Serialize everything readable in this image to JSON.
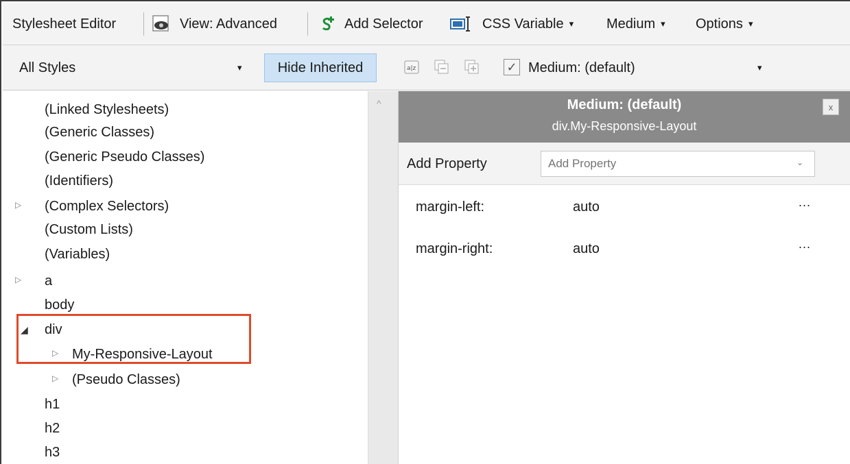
{
  "toolbar": {
    "title": "Stylesheet Editor",
    "view_label": "View: Advanced",
    "add_selector_label": "Add Selector",
    "css_variable_label": "CSS Variable",
    "medium_label": "Medium",
    "options_label": "Options",
    "caret": "▾"
  },
  "filter_bar": {
    "style_filter_value": "All Styles",
    "hide_inherited_label": "Hide Inherited",
    "medium_checked": "✓",
    "medium_value": "Medium: (default)",
    "dropdown_arrow": "▾"
  },
  "tree": {
    "items": [
      {
        "label": "(Linked Stylesheets)"
      },
      {
        "label": "(Generic Classes)"
      },
      {
        "label": "(Generic Pseudo Classes)"
      },
      {
        "label": "(Identifiers)"
      },
      {
        "label": "(Complex Selectors)"
      },
      {
        "label": "(Custom Lists)"
      },
      {
        "label": "(Variables)"
      },
      {
        "label": "a"
      },
      {
        "label": "body"
      },
      {
        "label": "div"
      },
      {
        "label": "My-Responsive-Layout"
      },
      {
        "label": "(Pseudo Classes)"
      },
      {
        "label": "h1"
      },
      {
        "label": "h2"
      },
      {
        "label": "h3"
      }
    ],
    "collapsed_glyph": "▷",
    "expanded_glyph": "◢"
  },
  "properties_panel": {
    "medium_title": "Medium: (default)",
    "selector": "div.My-Responsive-Layout",
    "close_glyph": "x",
    "add_property_label": "Add Property",
    "add_property_placeholder": "Add Property",
    "add_property_arrow": "⌄",
    "properties": [
      {
        "name": "margin-left:",
        "value": "auto",
        "more": "..."
      },
      {
        "name": "margin-right:",
        "value": "auto",
        "more": "..."
      }
    ]
  },
  "scroll_up_glyph": "^",
  "colors": {
    "toolbar_bg": "#f3f3f3",
    "hide_inherited_bg": "#cde2f5",
    "header_bg": "#8a8a8a",
    "highlight_border": "#e0492a",
    "add_selector_icon": "#1f8f3a"
  }
}
